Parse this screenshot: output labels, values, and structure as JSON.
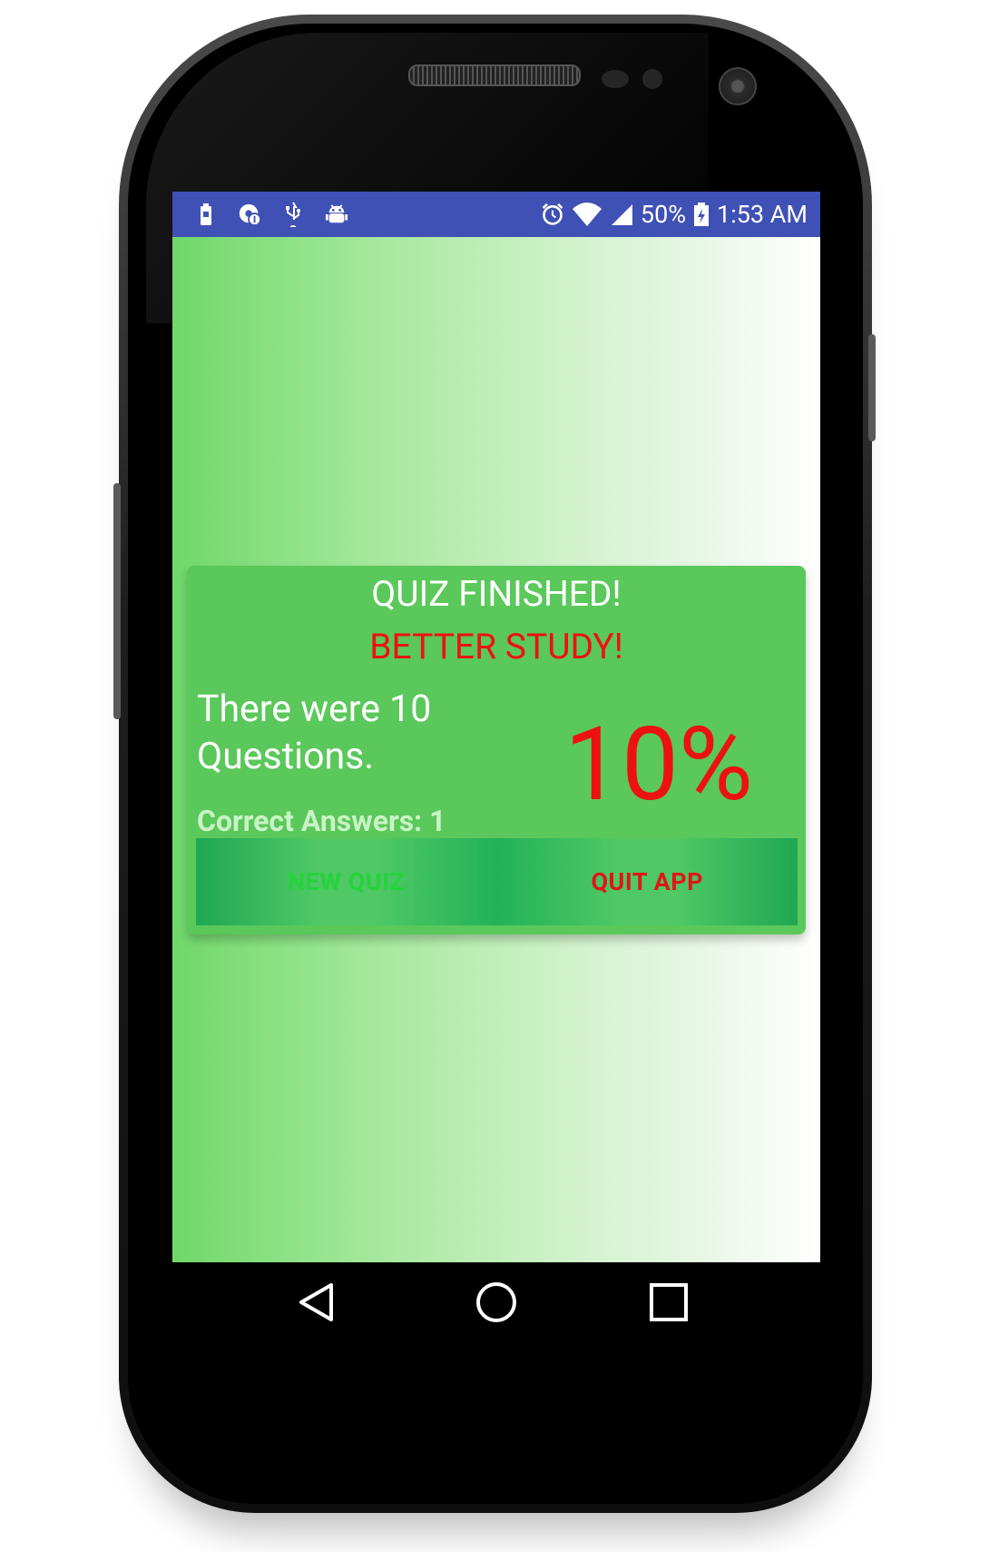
{
  "status_bar": {
    "battery_percent_text": "50%",
    "time": "1:53 AM",
    "left_icons": [
      "battery-saver-icon",
      "sync-icon",
      "usb-icon",
      "android-debug-icon"
    ],
    "right_icons": [
      "alarm-icon",
      "wifi-icon",
      "signal-icon",
      "battery-charging-icon"
    ],
    "color": "#3f51b5"
  },
  "result_card": {
    "title": "QUIZ FINISHED!",
    "verdict": "BETTER STUDY!",
    "questions_text": "There were 10 Questions.",
    "score_percent": "10%",
    "correct_answers": "Correct Answers: 1",
    "card_color": "#5ac85a",
    "accent_red": "#ee1111"
  },
  "buttons": {
    "new_quiz": "NEW QUIZ",
    "quit_app": "QUIT APP"
  },
  "nav_bar": {
    "icons": [
      "back-icon",
      "home-icon",
      "recents-icon"
    ]
  }
}
